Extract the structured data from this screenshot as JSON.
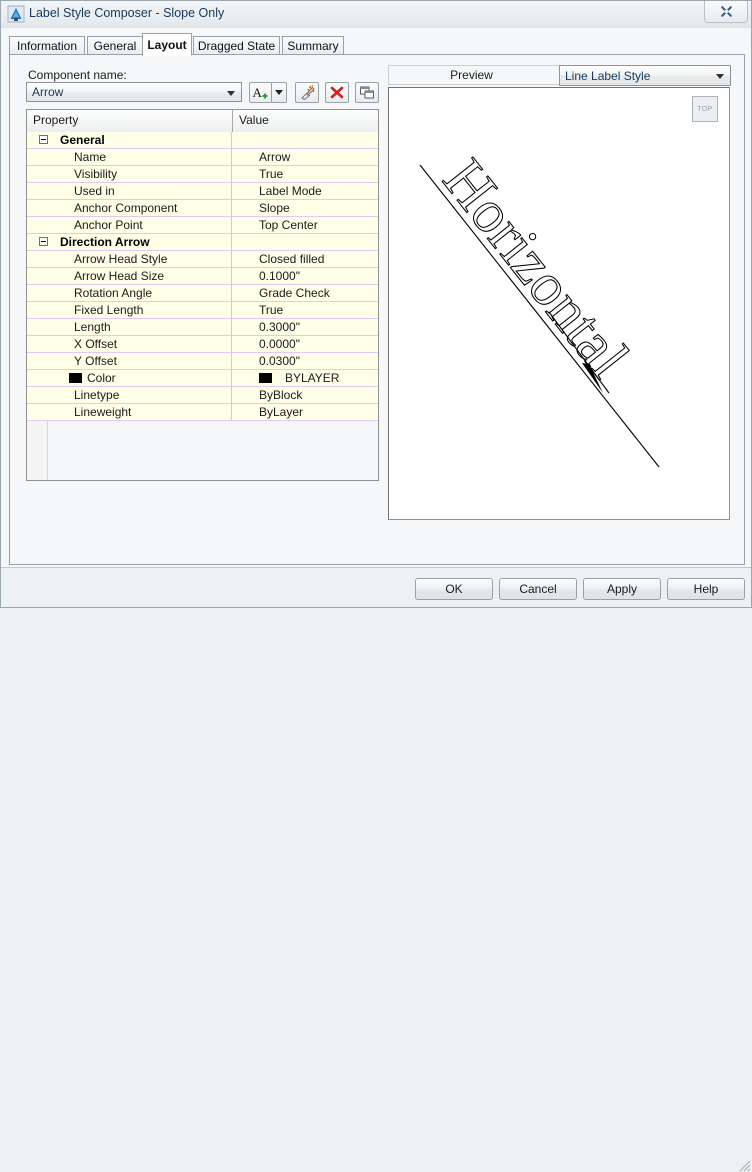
{
  "window": {
    "title": "Label Style Composer - Slope Only",
    "app_icon": "autocad-logo-icon",
    "close_label": "✕"
  },
  "tabs": [
    {
      "label": "Information",
      "active": false
    },
    {
      "label": "General",
      "active": false
    },
    {
      "label": "Layout",
      "active": true
    },
    {
      "label": "Dragged State",
      "active": false
    },
    {
      "label": "Summary",
      "active": false
    }
  ],
  "component": {
    "label": "Component name:",
    "value": "Arrow",
    "toolbar": [
      {
        "name": "create-text-component-button",
        "icon": "letter-a-plus-icon"
      },
      {
        "name": "create-component-dropdown-button",
        "icon": "chevron-down-icon"
      },
      {
        "name": "delete-all-components-button",
        "icon": "broom-sparkle-icon"
      },
      {
        "name": "delete-component-button",
        "icon": "red-x-icon"
      },
      {
        "name": "copy-component-button",
        "icon": "copy-windows-icon"
      }
    ]
  },
  "grid": {
    "columns": [
      "Property",
      "Value"
    ],
    "rows": [
      {
        "type": "category",
        "property": "General",
        "value": "",
        "expanded": true
      },
      {
        "type": "property",
        "property": "Name",
        "value": "Arrow"
      },
      {
        "type": "property",
        "property": "Visibility",
        "value": "True"
      },
      {
        "type": "property",
        "property": "Used in",
        "value": "Label Mode"
      },
      {
        "type": "property",
        "property": "Anchor Component",
        "value": "Slope"
      },
      {
        "type": "property",
        "property": "Anchor Point",
        "value": "Top Center"
      },
      {
        "type": "category",
        "property": "Direction Arrow",
        "value": "",
        "expanded": true
      },
      {
        "type": "property",
        "property": "Arrow Head Style",
        "value": "Closed filled"
      },
      {
        "type": "property",
        "property": "Arrow Head Size",
        "value": "0.1000\""
      },
      {
        "type": "property",
        "property": "Rotation Angle",
        "value": "Grade Check"
      },
      {
        "type": "property",
        "property": "Fixed Length",
        "value": "True"
      },
      {
        "type": "property",
        "property": "Length",
        "value": "0.3000\""
      },
      {
        "type": "property",
        "property": "X Offset",
        "value": "0.0000\""
      },
      {
        "type": "property",
        "property": "Y Offset",
        "value": "0.0300\""
      },
      {
        "type": "property",
        "property": "Color",
        "value": "BYLAYER",
        "swatch": "#000000",
        "value_swatch": "#000000"
      },
      {
        "type": "property",
        "property": "Linetype",
        "value": "ByBlock"
      },
      {
        "type": "property",
        "property": "Lineweight",
        "value": "ByLayer"
      }
    ]
  },
  "preview": {
    "title": "Preview",
    "style_value": "Line Label Style",
    "viewcube_label": "TOP",
    "drawing_text": "Horizontal"
  },
  "footer": {
    "ok": "OK",
    "cancel": "Cancel",
    "apply": "Apply",
    "help": "Help"
  },
  "colors": {
    "title_text": "#16385c",
    "grid_background": "#ffffe8",
    "grid_line": "#e3c9ef",
    "accent_red": "#cc2222",
    "panel": "#f6f7f8"
  }
}
